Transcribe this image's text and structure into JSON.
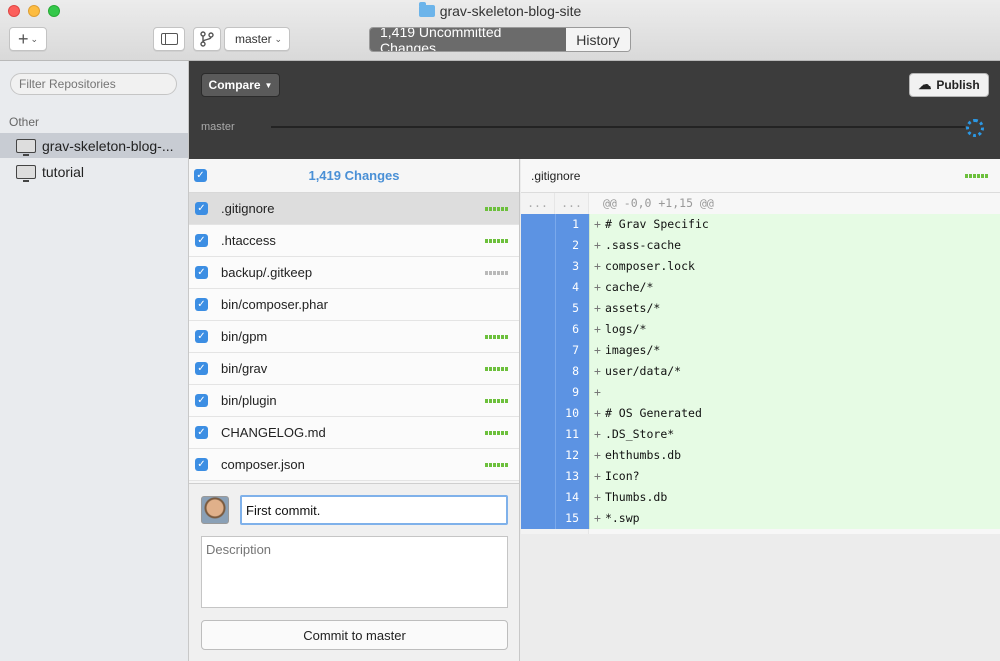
{
  "window": {
    "title": "grav-skeleton-blog-site"
  },
  "toolbar": {
    "add_glyph": "+",
    "chevron": "⌄",
    "branch": "master",
    "tabs": [
      {
        "label": "1,419 Uncommitted Changes",
        "active": true
      },
      {
        "label": "History",
        "active": false
      }
    ]
  },
  "sidebar": {
    "filter_placeholder": "Filter Repositories",
    "section": "Other",
    "repos": [
      {
        "name": "grav-skeleton-blog-...",
        "selected": true
      },
      {
        "name": "tutorial",
        "selected": false
      }
    ]
  },
  "darkbar": {
    "compare_label": "Compare",
    "publish_label": "Publish",
    "branch_label": "master"
  },
  "changes": {
    "title": "1,419 Changes",
    "files": [
      {
        "name": ".gitignore",
        "status": "green",
        "selected": true
      },
      {
        "name": ".htaccess",
        "status": "green",
        "selected": false
      },
      {
        "name": "backup/.gitkeep",
        "status": "gray",
        "selected": false
      },
      {
        "name": "bin/composer.phar",
        "status": "none",
        "selected": false
      },
      {
        "name": "bin/gpm",
        "status": "green",
        "selected": false
      },
      {
        "name": "bin/grav",
        "status": "green",
        "selected": false
      },
      {
        "name": "bin/plugin",
        "status": "green",
        "selected": false
      },
      {
        "name": "CHANGELOG.md",
        "status": "green",
        "selected": false
      },
      {
        "name": "composer.json",
        "status": "green",
        "selected": false
      }
    ]
  },
  "commit": {
    "summary": "First commit.",
    "description_placeholder": "Description",
    "button_label": "Commit to master"
  },
  "diff": {
    "file": ".gitignore",
    "hunk_left": "...",
    "hunk_right": "...",
    "hunk_header": "@@ -0,0 +1,15 @@",
    "lines": [
      {
        "num": "1",
        "text": "# Grav Specific"
      },
      {
        "num": "2",
        "text": ".sass-cache"
      },
      {
        "num": "3",
        "text": "composer.lock"
      },
      {
        "num": "4",
        "text": "cache/*"
      },
      {
        "num": "5",
        "text": "assets/*"
      },
      {
        "num": "6",
        "text": "logs/*"
      },
      {
        "num": "7",
        "text": "images/*"
      },
      {
        "num": "8",
        "text": "user/data/*"
      },
      {
        "num": "9",
        "text": ""
      },
      {
        "num": "10",
        "text": "# OS Generated"
      },
      {
        "num": "11",
        "text": ".DS_Store*"
      },
      {
        "num": "12",
        "text": "ehthumbs.db"
      },
      {
        "num": "13",
        "text": "Icon?"
      },
      {
        "num": "14",
        "text": "Thumbs.db"
      },
      {
        "num": "15",
        "text": "*.swp"
      }
    ]
  },
  "colors": {
    "accent": "#3c8ee3",
    "added_bg": "#e6fbe4",
    "gutter_blue": "#5c93e3",
    "status_green": "#6cc03c"
  }
}
